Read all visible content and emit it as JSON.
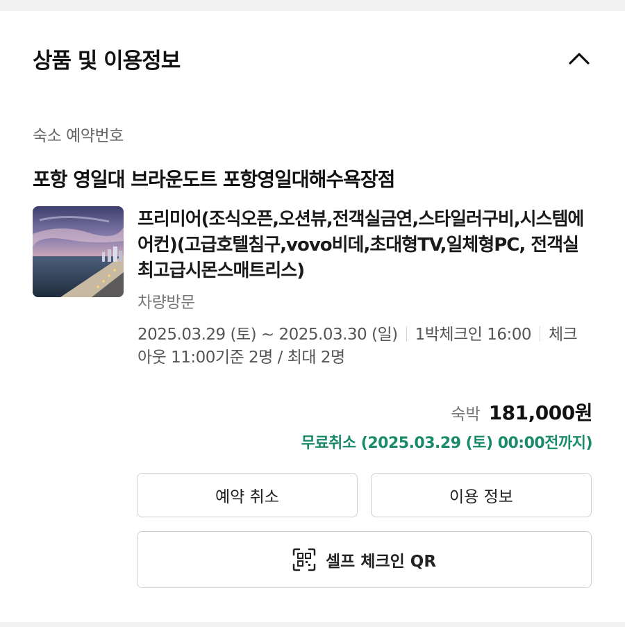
{
  "section": {
    "title": "상품 및 이용정보",
    "collapse_icon": "chevron-up-icon"
  },
  "reservation": {
    "label": "숙소 예약번호",
    "hotel_name": "포항 영일대 브라운도트 포항영일대해수욕장점"
  },
  "room": {
    "name": "프리미어(조식오픈,오션뷰,전객실금연,스타일러구비,시스템에어컨)(고급호텔침구,vovo비데,초대형TV,일체형PC, 전객실최고급시몬스매트리스)",
    "type": "차량방문",
    "image_icon": "hotel-thumbnail-image"
  },
  "stay": {
    "date_range": "2025.03.29 (토) ~ 2025.03.30 (일)",
    "nights": "1박",
    "checkin": "체크인 16:00",
    "checkout": "체크아웃 11:00",
    "guests": "기준 2명 / 최대 2명"
  },
  "price": {
    "label": "숙박",
    "value": "181,000원"
  },
  "cancellation": {
    "text": "무료취소 (2025.03.29 (토) 00:00전까지)",
    "color": "#1a8a6a"
  },
  "actions": {
    "cancel_label": "예약 취소",
    "info_label": "이용 정보",
    "qr_label": "셀프 체크인 QR",
    "qr_icon": "qr-code-icon"
  }
}
